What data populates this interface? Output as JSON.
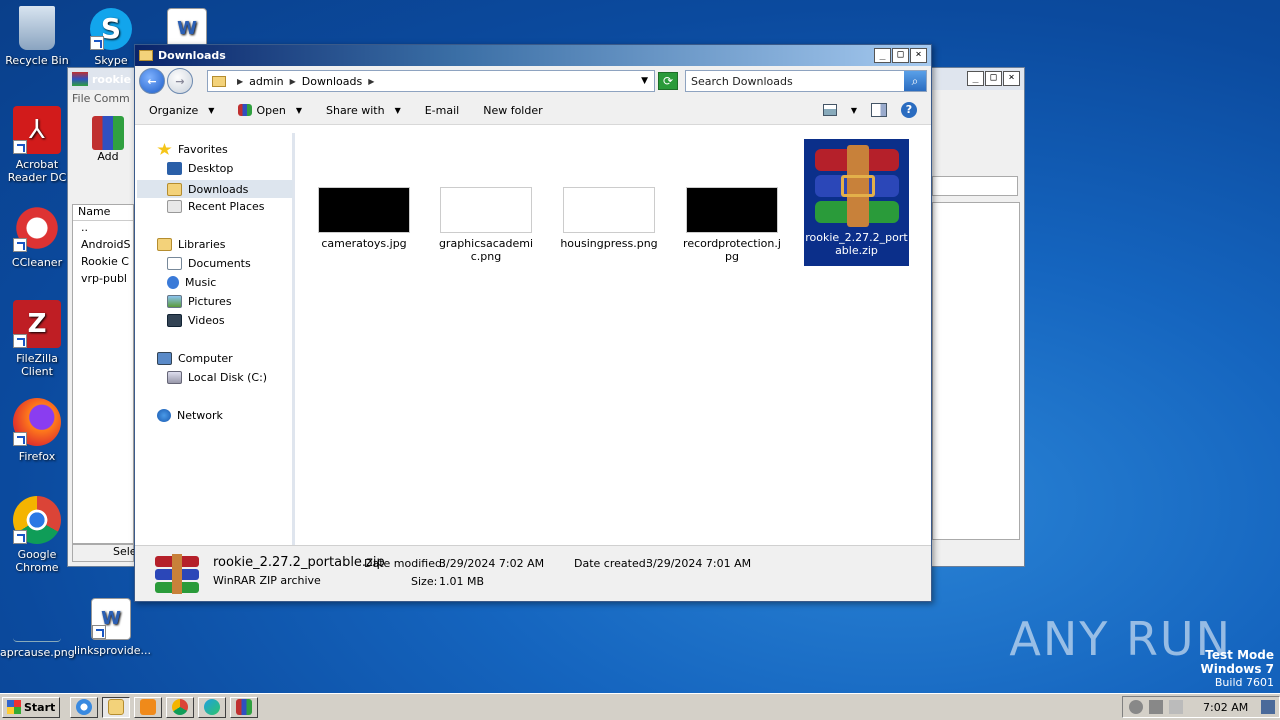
{
  "desktop": {
    "icons": [
      {
        "label": "Recycle Bin",
        "icon": "recycle-bin-icon"
      },
      {
        "label": "Skype",
        "icon": "skype-icon"
      },
      {
        "label": "Acrobat Reader DC",
        "icon": "acrobat-icon"
      },
      {
        "label": "CCleaner",
        "icon": "ccleaner-icon"
      },
      {
        "label": "FileZilla Client",
        "icon": "filezilla-icon"
      },
      {
        "label": "Firefox",
        "icon": "firefox-icon"
      },
      {
        "label": "Google Chrome",
        "icon": "chrome-icon"
      },
      {
        "label": "aprcause.png",
        "icon": "image-file-icon"
      },
      {
        "label": "linksprovide...",
        "icon": "word-document-icon"
      }
    ]
  },
  "back_window": {
    "title": "rookie",
    "menu": "File   Comm",
    "add_label": "Add",
    "name_header": "Name",
    "rows": [
      "..",
      "AndroidS",
      "Rookie C",
      "vrp-publ"
    ],
    "status": "Sele"
  },
  "explorer": {
    "title": "Downloads",
    "breadcrumb": [
      "admin",
      "Downloads"
    ],
    "search_placeholder": "Search Downloads",
    "toolbar": {
      "organize": "Organize",
      "open": "Open",
      "share_with": "Share with",
      "email": "E-mail",
      "new_folder": "New folder"
    },
    "nav": {
      "favorites": "Favorites",
      "desktop": "Desktop",
      "downloads": "Downloads",
      "recent_places": "Recent Places",
      "libraries": "Libraries",
      "documents": "Documents",
      "music": "Music",
      "pictures": "Pictures",
      "videos": "Videos",
      "computer": "Computer",
      "local_disk": "Local Disk (C:)",
      "network": "Network"
    },
    "files": [
      {
        "name": "cameratoys.jpg",
        "thumb": "#000000"
      },
      {
        "name": "graphicsacademic.png",
        "thumb": "#ffffff"
      },
      {
        "name": "housingpress.png",
        "thumb": "#ffffff"
      },
      {
        "name": "recordprotection.jpg",
        "thumb": "#000000"
      },
      {
        "name": "rookie_2.27.2_portable.zip",
        "thumb": "winrar",
        "selected": true
      }
    ],
    "details": {
      "filename": "rookie_2.27.2_portable.zip",
      "type": "WinRAR ZIP archive",
      "date_modified_label": "Date modified:",
      "date_modified": "3/29/2024 7:02 AM",
      "date_created_label": "Date created:",
      "date_created": "3/29/2024 7:01 AM",
      "size_label": "Size:",
      "size": "1.01 MB"
    }
  },
  "taskbar": {
    "start": "Start",
    "clock": "7:02 AM"
  },
  "watermark": "ANY RUN",
  "test_mode": {
    "line1": "Test Mode",
    "line2": "Windows 7",
    "line3": "Build 7601"
  },
  "colors": {
    "selection": "#0b2f8a",
    "desktop": "#1565bf"
  }
}
